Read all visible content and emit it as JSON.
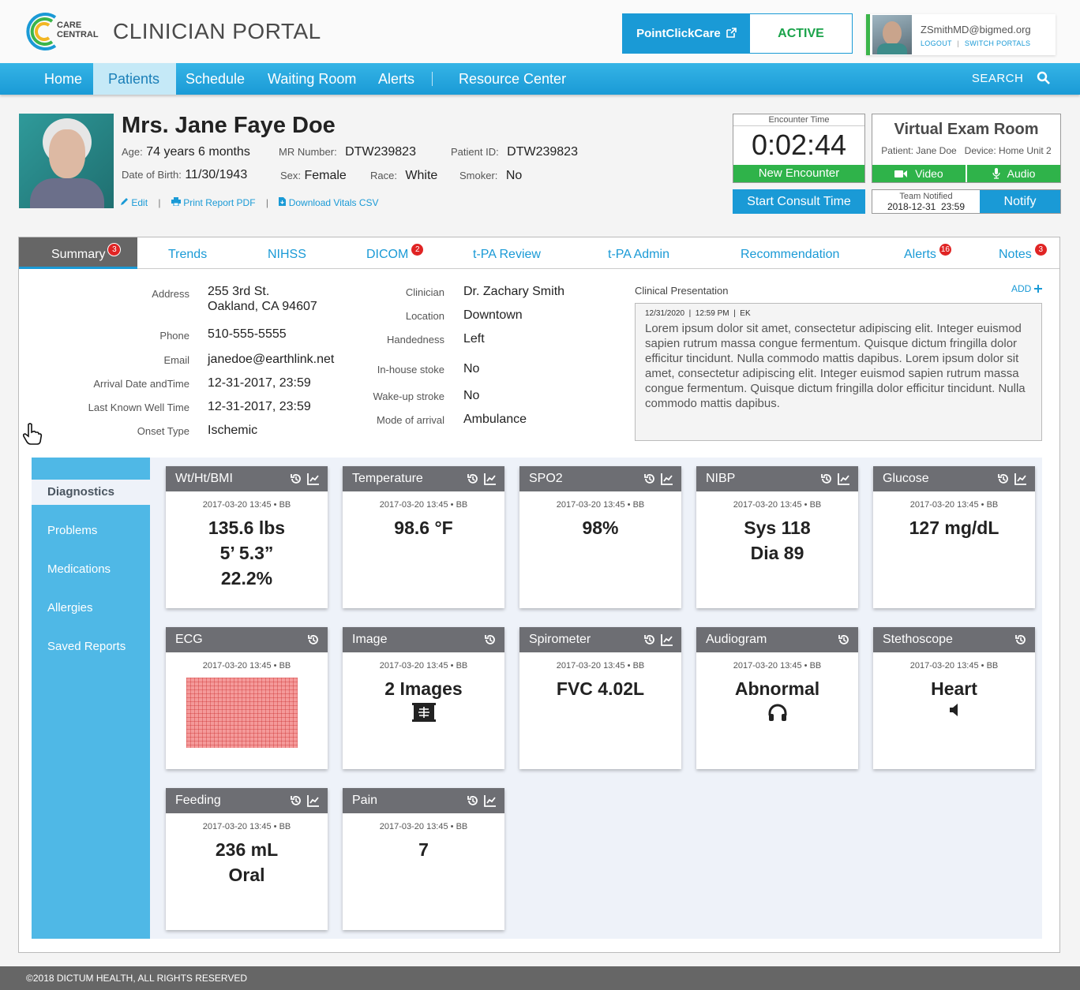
{
  "header": {
    "logo_line1": "CARE",
    "logo_line2": "CENTRAL",
    "portal_title": "CLINICIAN PORTAL",
    "pcc_label": "PointClickCare",
    "pcc_status": "ACTIVE",
    "user_email": "ZSmithMD@bigmed.org",
    "logout": "LOGOUT",
    "switch_portals": "SWITCH PORTALS"
  },
  "nav": {
    "items": [
      "Home",
      "Patients",
      "Schedule",
      "Waiting Room",
      "Alerts",
      "Resource Center"
    ],
    "active": "Patients",
    "search": "SEARCH"
  },
  "patient": {
    "name": "Mrs. Jane Faye Doe",
    "age_label": "Age:",
    "age": "74 years 6 months",
    "dob_label": "Date of Birth:",
    "dob": "11/30/1943",
    "mr_label": "MR Number:",
    "mr": "DTW239823",
    "sex_label": "Sex:",
    "sex": "Female",
    "pid_label": "Patient ID:",
    "pid": "DTW239823",
    "race_label": "Race:",
    "race": "White",
    "smoker_label": "Smoker:",
    "smoker": "No",
    "actions": [
      "Edit",
      "Print Report PDF",
      "Download Vitals CSV"
    ]
  },
  "encounter": {
    "label": "Encounter Time",
    "time": "0:02:44",
    "new_encounter": "New Encounter",
    "start_consult": "Start Consult Time"
  },
  "virtual_exam": {
    "title": "Virtual Exam Room",
    "subtitle": "Patient: Jane Doe   Device: Home Unit 2",
    "video": "Video",
    "audio": "Audio",
    "team_label": "Team Notified",
    "team_date": "2018-12-31  23:59",
    "notify": "Notify"
  },
  "tabs": [
    {
      "label": "Summary",
      "badge": "3"
    },
    {
      "label": "Trends",
      "badge": ""
    },
    {
      "label": "NIHSS",
      "badge": ""
    },
    {
      "label": "DICOM",
      "badge": "2"
    },
    {
      "label": "t-PA Review",
      "badge": ""
    },
    {
      "label": "t-PA Admin",
      "badge": ""
    },
    {
      "label": "Recommendation",
      "badge": ""
    },
    {
      "label": "Alerts",
      "badge": "16"
    },
    {
      "label": "Notes",
      "badge": "3"
    }
  ],
  "summary": {
    "left": [
      {
        "label": "Address",
        "value": "255 3rd St.",
        "value2": "Oakland, CA 94607"
      },
      {
        "label": "Phone",
        "value": "510-555-5555"
      },
      {
        "label": "Email",
        "value": "janedoe@earthlink.net"
      },
      {
        "label": "Arrival Date andTime",
        "value": "12-31-2017, 23:59"
      },
      {
        "label": "Last Known Well Time",
        "value": "12-31-2017, 23:59"
      },
      {
        "label": "Onset Type",
        "value": "Ischemic"
      }
    ],
    "middle": [
      {
        "label": "Clinician",
        "value": "Dr. Zachary Smith"
      },
      {
        "label": "Location",
        "value": "Downtown"
      },
      {
        "label": "Handedness",
        "value": "Left"
      },
      {
        "label": "In-house stoke",
        "value": "No"
      },
      {
        "label": "Wake-up stroke",
        "value": "No"
      },
      {
        "label": "Mode of arrival",
        "value": "Ambulance"
      }
    ],
    "clinical_label": "Clinical Presentation",
    "add_label": "ADD",
    "clinical_meta": "12/31/2020  |  12:59 PM  |  EK",
    "clinical_text": "Lorem ipsum dolor sit amet, consectetur adipiscing elit. Integer euismod sapien rutrum massa congue fermentum. Quisque dictum fringilla dolor efficitur tincidunt. Nulla commodo mattis dapibus. Lorem ipsum dolor sit amet, consectetur adipiscing elit. Integer euismod sapien rutrum massa congue fermentum. Quisque dictum fringilla dolor efficitur tincidunt. Nulla commodo mattis dapibus."
  },
  "sidebar": [
    "Diagnostics",
    "Problems",
    "Medications",
    "Allergies",
    "Saved Reports"
  ],
  "tiles": [
    {
      "title": "Wt/Ht/BMI",
      "meta": "2017-03-20 13:45 • BB",
      "lines": [
        "135.6 lbs",
        "5’ 5.3”",
        "22.2%"
      ],
      "trend": true,
      "icon": ""
    },
    {
      "title": "Temperature",
      "meta": "2017-03-20 13:45 • BB",
      "lines": [
        "98.6 °F"
      ],
      "trend": true,
      "icon": ""
    },
    {
      "title": "SPO2",
      "meta": "2017-03-20 13:45 • BB",
      "lines": [
        "98%"
      ],
      "trend": true,
      "icon": ""
    },
    {
      "title": "NIBP",
      "meta": "2017-03-20 13:45 • BB",
      "lines": [
        "Sys 118",
        "Dia 89"
      ],
      "trend": true,
      "icon": ""
    },
    {
      "title": "Glucose",
      "meta": "2017-03-20 13:45 • BB",
      "lines": [
        "127 mg/dL"
      ],
      "trend": true,
      "icon": ""
    },
    {
      "title": "ECG",
      "meta": "2017-03-20 13:45 • BB",
      "lines": [],
      "trend": false,
      "icon": "ecg-strip"
    },
    {
      "title": "Image",
      "meta": "2017-03-20 13:45 • BB",
      "lines": [
        "2 Images"
      ],
      "trend": false,
      "icon": "xray-icon"
    },
    {
      "title": "Spirometer",
      "meta": "2017-03-20 13:45 • BB",
      "lines": [
        "FVC 4.02L"
      ],
      "trend": true,
      "icon": ""
    },
    {
      "title": "Audiogram",
      "meta": "2017-03-20 13:45 • BB",
      "lines": [
        "Abnormal"
      ],
      "trend": false,
      "icon": "headphones-icon"
    },
    {
      "title": "Stethoscope",
      "meta": "2017-03-20 13:45 • BB",
      "lines": [
        "Heart"
      ],
      "trend": false,
      "icon": "speaker-icon"
    },
    {
      "title": "Feeding",
      "meta": "2017-03-20 13:45 • BB",
      "lines": [
        "236 mL",
        "Oral"
      ],
      "trend": true,
      "icon": ""
    },
    {
      "title": "Pain",
      "meta": "2017-03-20 13:45 • BB",
      "lines": [
        "7"
      ],
      "trend": true,
      "icon": ""
    }
  ],
  "footer": "©2018 DICTUM HEALTH, ALL RIGHTS RESERVED",
  "colors": {
    "brand_blue": "#1a9ad6",
    "active_green": "#2fb34a",
    "badge_red": "#e02424",
    "tile_header": "#6d6e73"
  }
}
